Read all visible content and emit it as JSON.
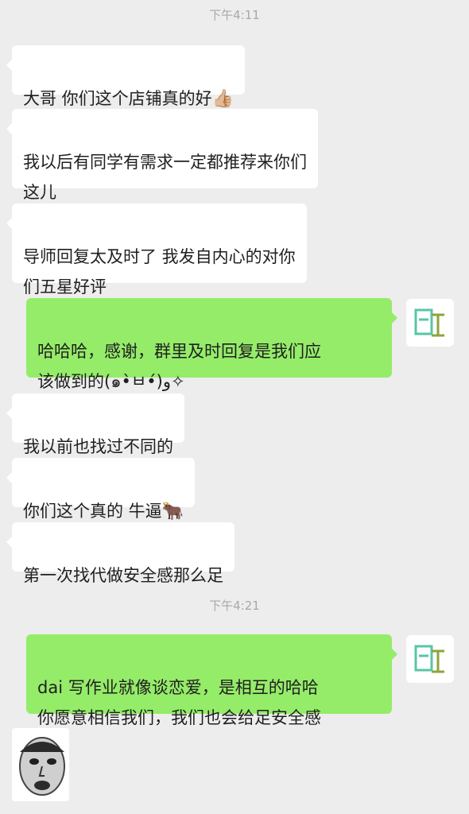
{
  "timestamps": [
    "下午4:11",
    "下午4:21"
  ],
  "messages": [
    {
      "side": "in",
      "text": "大哥 你们这个店铺真的好",
      "emoji": "👍🏼"
    },
    {
      "side": "in",
      "text": "我以后有同学有需求一定都推荐来你们\n这儿"
    },
    {
      "side": "in",
      "text": "导师回复太及时了 我发自内心的对你\n们五星好评"
    },
    {
      "side": "out",
      "text": "哈哈哈，感谢，群里及时回复是我们应\n该做到的(๑•̀ㅂ•́)و✧"
    },
    {
      "side": "in",
      "text": "我以前也找过不同的"
    },
    {
      "side": "in",
      "text": "你们这个真的 牛逼",
      "emoji": "🐂"
    },
    {
      "side": "in",
      "text": "第一次找代做安全感那么足"
    },
    {
      "side": "out",
      "text": "dai 写作业就像谈恋爱，是相互的哈哈\n你愿意相信我们，我们也会给足安全感"
    }
  ],
  "icons": {
    "like": "thumbs-up-icon",
    "ox": "ox-icon",
    "avatar": "company-logo-avatar",
    "sticker": "meme-face-sticker"
  },
  "colors": {
    "background": "#ededed",
    "incoming_bubble": "#ffffff",
    "outgoing_bubble": "#95ec69",
    "timestamp": "#a8a8a8"
  }
}
